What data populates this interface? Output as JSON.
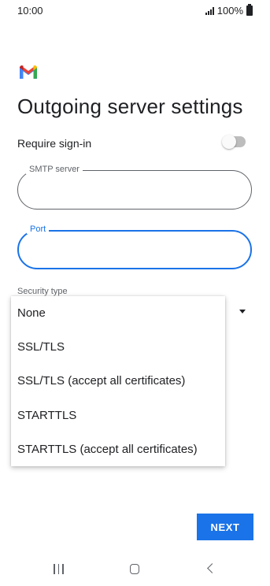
{
  "status_bar": {
    "time": "10:00",
    "battery_text": "100%",
    "icons": [
      "signal-icon",
      "battery-icon"
    ]
  },
  "app": {
    "logo": "gmail-logo",
    "brand_colors": {
      "red": "#ea4335",
      "blue": "#4285f4",
      "green": "#34a853",
      "yellow": "#fbbc04",
      "dark_red": "#c5221f"
    }
  },
  "page": {
    "title": "Outgoing server settings"
  },
  "require_signin": {
    "label": "Require sign-in",
    "enabled": false
  },
  "fields": {
    "smtp_server": {
      "label": "SMTP server",
      "value": ""
    },
    "port": {
      "label": "Port",
      "value": ""
    }
  },
  "security": {
    "label": "Security type",
    "options": [
      "None",
      "SSL/TLS",
      "SSL/TLS (accept all certificates)",
      "STARTTLS",
      "STARTTLS (accept all certificates)"
    ]
  },
  "actions": {
    "next_label": "NEXT",
    "accent": "#1a73e8"
  },
  "nav_bar": {
    "icons": [
      "recent-apps-icon",
      "home-icon",
      "back-icon"
    ]
  }
}
